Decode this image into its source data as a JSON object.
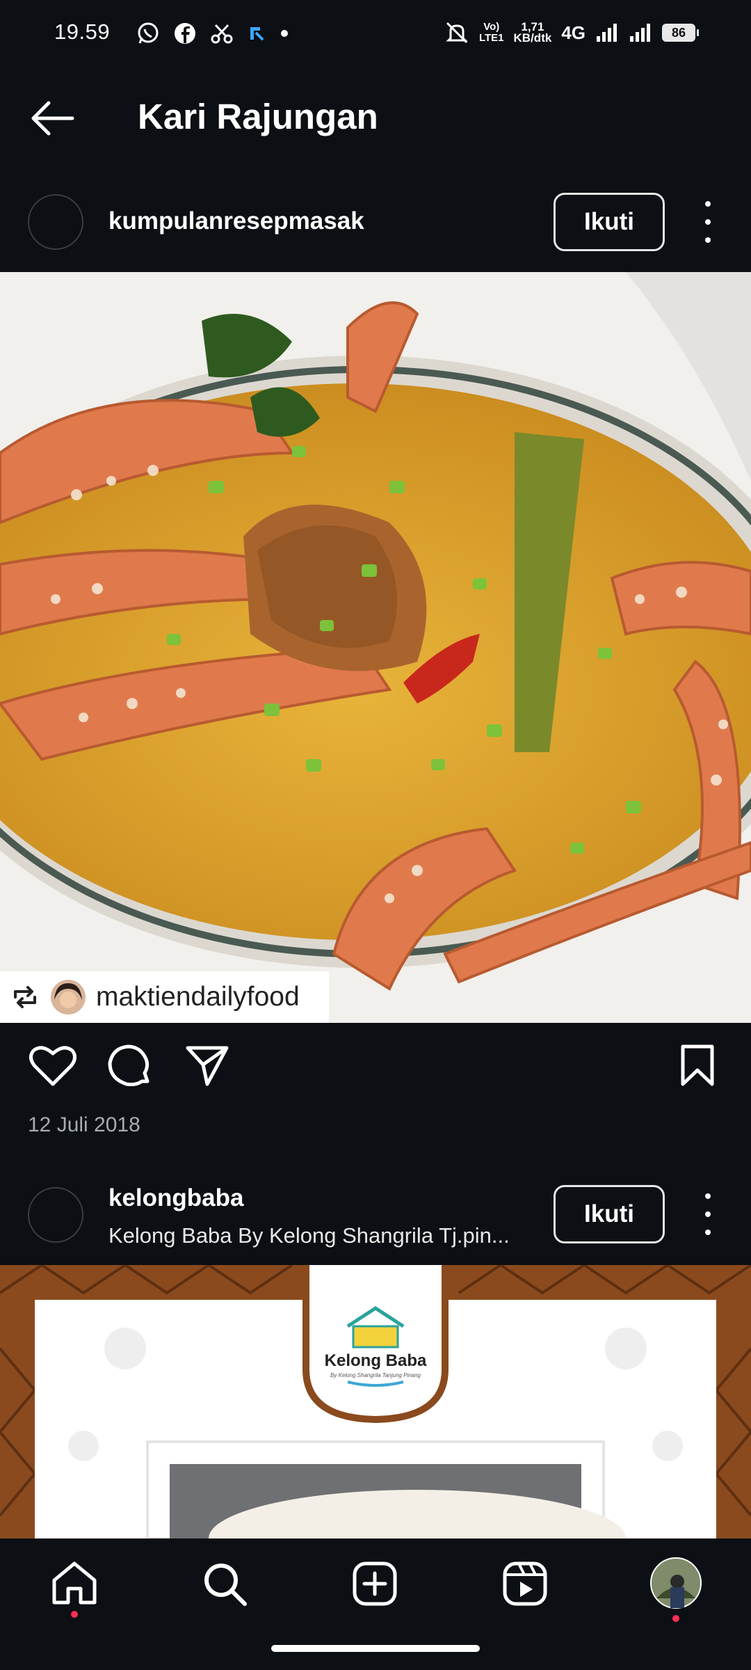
{
  "status_bar": {
    "time": "19.59",
    "network_top": "Vo)",
    "network_bottom": "LTE1",
    "speed_value": "1,71",
    "speed_unit": "KB/dtk",
    "net_type": "4G",
    "battery": "86",
    "icons": [
      "whatsapp-icon",
      "facebook-icon",
      "scissor-app-icon",
      "app-icon",
      "dot-icon",
      "mute-icon",
      "signal-icon",
      "signal-icon",
      "battery-icon"
    ]
  },
  "header": {
    "title": "Kari Rajungan",
    "back_icon": "arrow-left-icon"
  },
  "post1": {
    "username": "kumpulanresepmasak",
    "follow_label": "Ikuti",
    "repost_user": "maktiendailyfood",
    "date": "12 Juli 2018",
    "actions": [
      "heart-icon",
      "comment-icon",
      "share-icon",
      "bookmark-icon"
    ]
  },
  "post2": {
    "username": "kelongbaba",
    "subtitle": "Kelong Baba By Kelong Shangrila Tj.pin...",
    "follow_label": "Ikuti",
    "logo_text": "Kelong Baba",
    "logo_tagline": "By Kelong Shangrila Tanjung Pinang"
  },
  "bottom_nav": {
    "items": [
      "home-icon",
      "search-icon",
      "add-post-icon",
      "reels-icon",
      "profile-avatar"
    ]
  },
  "colors": {
    "background": "#0c0f14",
    "text": "#ffffff",
    "muted": "#a8acb2",
    "curry": "#e0a52a",
    "crab": "#e07a4c",
    "notification": "#ff2d55"
  }
}
